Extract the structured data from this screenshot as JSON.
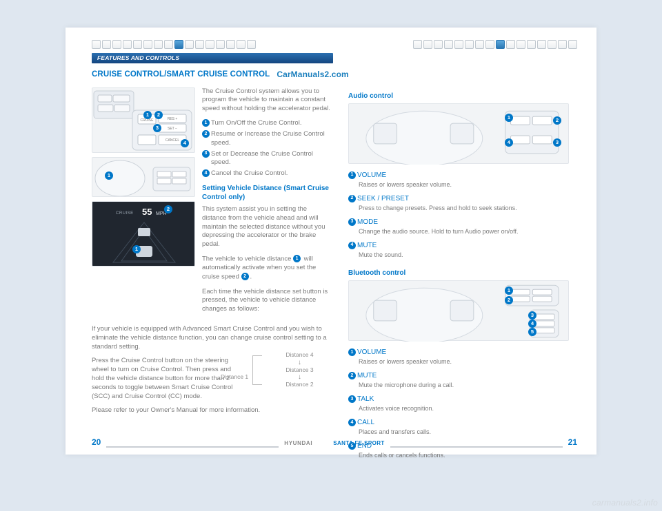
{
  "header": {
    "section_label": "FEATURES AND CONTROLS",
    "title": "CRUISE CONTROL/SMART CRUISE CONTROL",
    "watermark_link": "CarManuals2.com"
  },
  "cruise": {
    "intro": "The Cruise Control system allows you to program the vehicle to maintain a constant speed without holding the accelerator pedal.",
    "items": [
      "Turn On/Off the Cruise Control.",
      "Resume or Increase the Cruise Control speed.",
      "Set or Decrease the Cruise Control speed.",
      "Cancel the Cruise Control."
    ],
    "dist_heading": "Setting Vehicle Distance (Smart Cruise Control only)",
    "dist_para1": "This system assist you in setting the distance from the vehicle ahead and will maintain the selected distance without you depressing the accelerator or the brake pedal.",
    "dist_para2a": "The vehicle to vehicle distance ",
    "dist_para2b": " will automatically activate when you set the cruise speed ",
    "dist_para2c": ".",
    "dist_para3": "Each time the vehicle distance set button is pressed, the vehicle to vehicle distance changes as follows:",
    "full_para1": "If your vehicle is equipped with Advanced Smart Cruise Control and you wish to eliminate the vehicle distance function, you can change cruise control setting to a standard setting.",
    "full_para2": "Press the Cruise Control button on the steering wheel to turn on Cruise Control. Then press and hold the vehicle distance button for more than 2 seconds to toggle between Smart Cruise Control (SCC) and Cruise Control (CC) mode.",
    "full_para3": "Please refer to your Owner's Manual for more information.",
    "cluster_speed": "55",
    "cluster_unit": "MPH",
    "cluster_label": "CRUISE",
    "distances": [
      "Distance 4",
      "Distance 3",
      "Distance 2",
      "Distance 1"
    ]
  },
  "audio": {
    "heading": "Audio control",
    "items": [
      {
        "label": "VOLUME",
        "desc": "Raises or lowers speaker volume."
      },
      {
        "label": "SEEK / PRESET",
        "desc": "Press to change presets. Press and hold to seek stations."
      },
      {
        "label": "MODE",
        "desc": "Change the audio source. Hold to turn Audio power on/off."
      },
      {
        "label": "MUTE",
        "desc": "Mute the sound."
      }
    ]
  },
  "bluetooth": {
    "heading": "Bluetooth control",
    "items": [
      {
        "label": "VOLUME",
        "desc": "Raises or lowers speaker volume."
      },
      {
        "label": "MUTE",
        "desc": "Mute the microphone during a call."
      },
      {
        "label": "TALK",
        "desc": "Activates voice recognition."
      },
      {
        "label": "CALL",
        "desc": "Places and transfers calls."
      },
      {
        "label": "END",
        "desc": "Ends calls or cancels functions."
      }
    ]
  },
  "footer": {
    "page_left": "20",
    "brand": "HYUNDAI",
    "model": "SANTA FE SPORT",
    "page_right": "21"
  },
  "watermark_corner": "carmanuals2.info",
  "badges": {
    "b1": "1",
    "b2": "2",
    "b3": "3",
    "b4": "4",
    "b5": "5"
  }
}
